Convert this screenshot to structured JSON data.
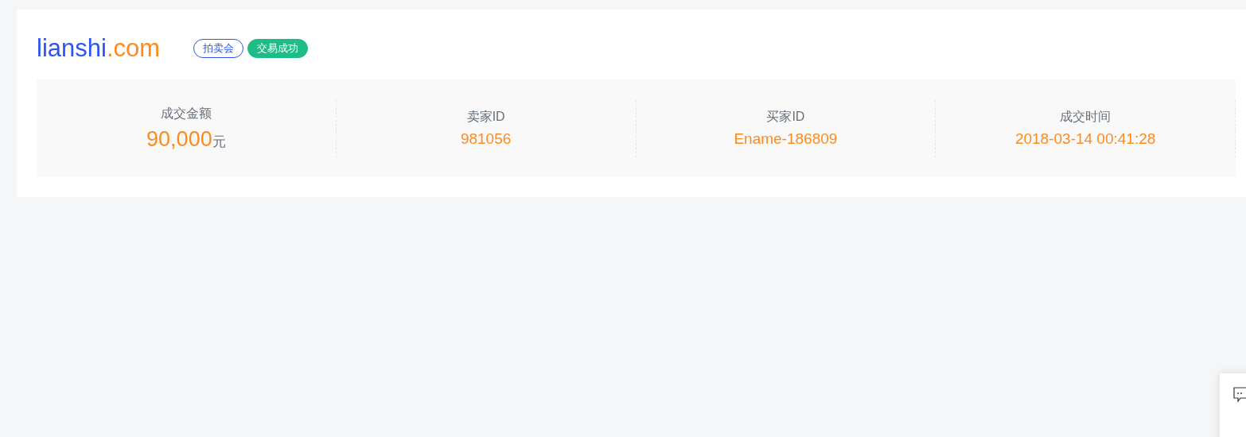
{
  "logo": {
    "name": "lianshi",
    "tld": ".com"
  },
  "tags": [
    {
      "label": "拍卖会",
      "kind": "outline"
    },
    {
      "label": "交易成功",
      "kind": "solid"
    }
  ],
  "stats": [
    {
      "label": "成交金额",
      "value": "90,000",
      "unit": "元"
    },
    {
      "label": "卖家ID",
      "value": "981056"
    },
    {
      "label": "买家ID",
      "value": "Ename-186809"
    },
    {
      "label": "成交时间",
      "value": "2018-03-14 00:41:28"
    }
  ]
}
